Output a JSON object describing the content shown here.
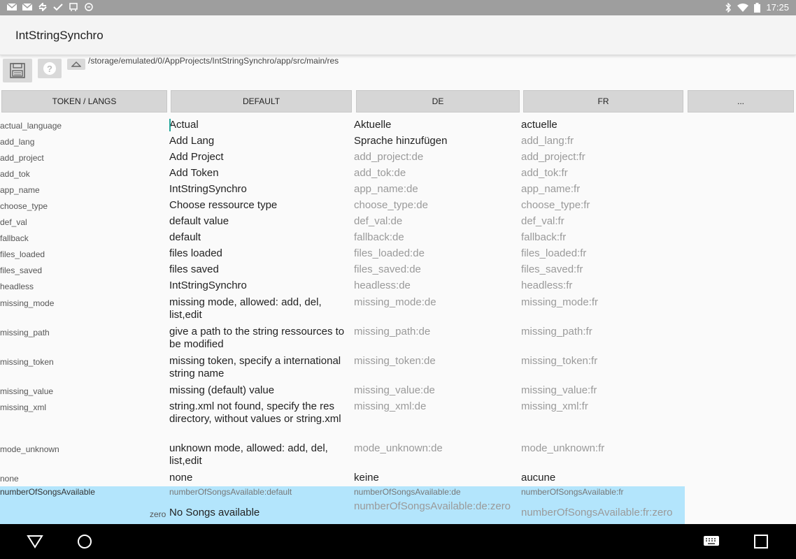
{
  "status": {
    "time": "17:25"
  },
  "app": {
    "title": "IntStringSynchro"
  },
  "toolbar": {
    "path": "/storage/emulated/0/AppProjects/IntStringSynchro/app/src/main/res"
  },
  "columns": [
    "TOKEN / LANGS",
    "DEFAULT",
    "DE",
    "FR",
    "..."
  ],
  "rows": [
    {
      "token": "actual_language",
      "default": "Actual",
      "de": "Aktuelle",
      "fr": "actuelle"
    },
    {
      "token": "add_lang",
      "default": "Add Lang",
      "de": "Sprache hinzufügen",
      "fr": "add_lang:fr"
    },
    {
      "token": "add_project",
      "default": "Add Project",
      "de": "add_project:de",
      "fr": "add_project:fr"
    },
    {
      "token": "add_tok",
      "default": "Add Token",
      "de": "add_tok:de",
      "fr": "add_tok:fr"
    },
    {
      "token": "app_name",
      "default": "IntStringSynchro",
      "de": "app_name:de",
      "fr": "app_name:fr"
    },
    {
      "token": "choose_type",
      "default": "Choose ressource type",
      "de": "choose_type:de",
      "fr": "choose_type:fr"
    },
    {
      "token": "def_val",
      "default": "default value",
      "de": "def_val:de",
      "fr": "def_val:fr"
    },
    {
      "token": "fallback",
      "default": "default",
      "de": "fallback:de",
      "fr": "fallback:fr"
    },
    {
      "token": "files_loaded",
      "default": "files loaded",
      "de": "files_loaded:de",
      "fr": "files_loaded:fr"
    },
    {
      "token": "files_saved",
      "default": "files saved",
      "de": "files_saved:de",
      "fr": "files_saved:fr"
    },
    {
      "token": "headless",
      "default": "IntStringSynchro",
      "de": "headless:de",
      "fr": "headless:fr"
    },
    {
      "token": "missing_mode",
      "default": "missing mode, allowed: add, del, list,edit",
      "de": "missing_mode:de",
      "fr": "missing_mode:fr"
    },
    {
      "token": "missing_path",
      "default": "give a path to the string ressources to be modified",
      "de": "missing_path:de",
      "fr": "missing_path:fr"
    },
    {
      "token": "missing_token",
      "default": "missing token, specify a international string name",
      "de": "missing_token:de",
      "fr": "missing_token:fr"
    },
    {
      "token": "missing_value",
      "default": "missing (default) value",
      "de": "missing_value:de",
      "fr": "missing_value:fr"
    },
    {
      "token": "missing_xml",
      "default": "string.xml not found, specify the res directory, without values or string.xml",
      "de": "missing_xml:de",
      "fr": "missing_xml:fr"
    },
    {
      "token": "mode_unknown",
      "default": "unknown mode, allowed: add, del, list,edit",
      "de": "mode_unknown:de",
      "fr": "mode_unknown:fr"
    },
    {
      "token": "none",
      "default": "none",
      "de": "keine",
      "fr": "aucune"
    }
  ],
  "plural": {
    "token": "numberOfSongsAvailable",
    "default": "numberOfSongsAvailable:default",
    "de": "numberOfSongsAvailable:de",
    "fr": "numberOfSongsAvailable:fr",
    "quantity": "zero",
    "zero_default": "No Songs available",
    "zero_de": "numberOfSongsAvailable:de:zero",
    "zero_fr": "numberOfSongsAvailable:fr:zero"
  }
}
